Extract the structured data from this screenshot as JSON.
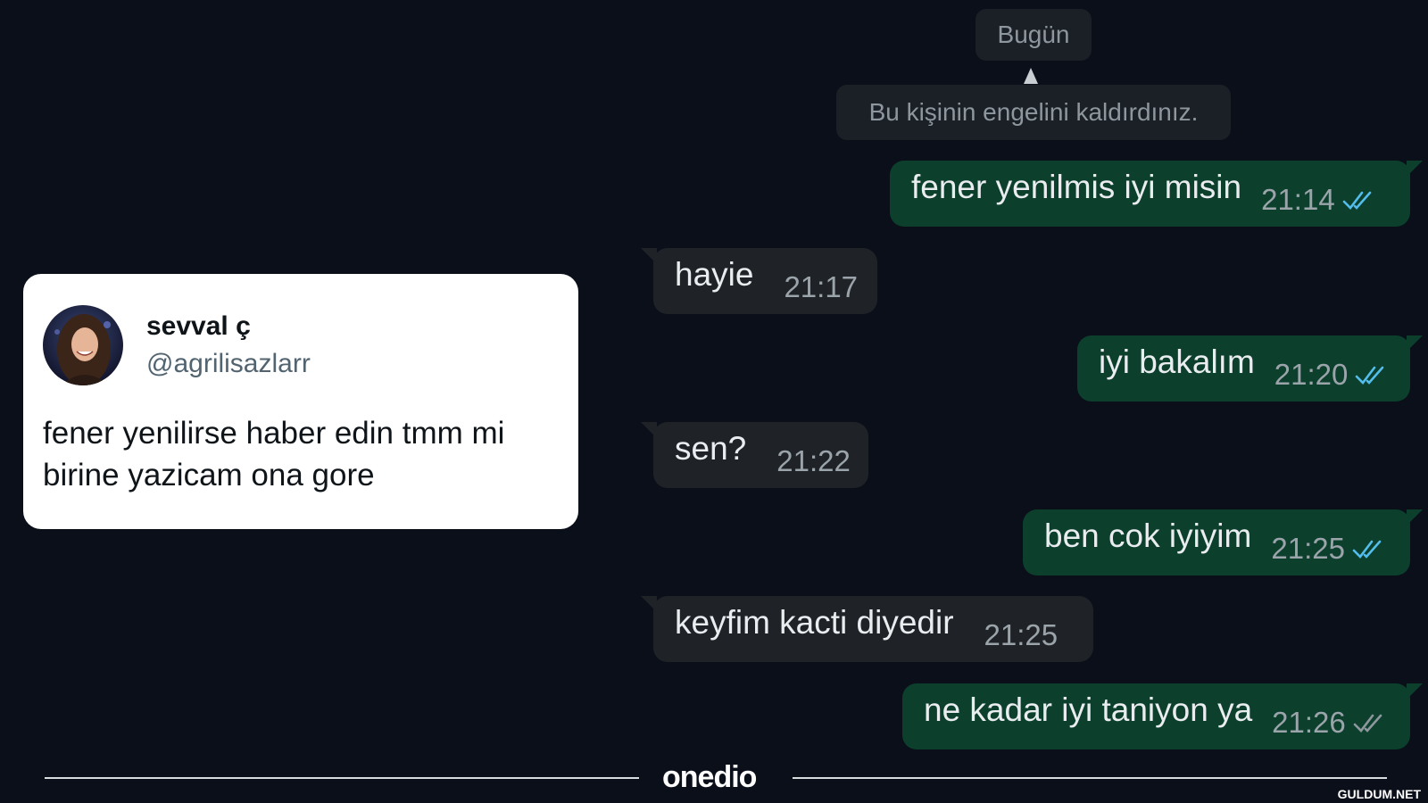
{
  "chat": {
    "date_label": "Bugün",
    "system_message": "Bu kişinin engelini kaldırdınız.",
    "messages": [
      {
        "direction": "out",
        "text": "fener yenilmis iyi misin",
        "time": "21:14",
        "status": "read"
      },
      {
        "direction": "in",
        "text": "hayie",
        "time": "21:17"
      },
      {
        "direction": "out",
        "text": "iyi bakalım",
        "time": "21:20",
        "status": "read"
      },
      {
        "direction": "in",
        "text": "sen?",
        "time": "21:22"
      },
      {
        "direction": "out",
        "text": "ben cok iyiyim",
        "time": "21:25",
        "status": "read"
      },
      {
        "direction": "in",
        "text": "keyfim kacti diyedir",
        "time": "21:25"
      },
      {
        "direction": "out",
        "text": "ne kadar iyi taniyon ya",
        "time": "21:26",
        "status": "delivered"
      }
    ]
  },
  "tweet": {
    "display_name": "sevval ç",
    "handle": "@agrilisazlarr",
    "text": "fener yenilirse haber edin tmm mi birine yazicam ona gore"
  },
  "footer": {
    "brand": "onedio",
    "watermark": "GULDUM.NET"
  },
  "colors": {
    "background": "#0a0f1a",
    "outgoing_bubble": "#0c3f2c",
    "incoming_bubble": "#1f2327",
    "read_tick": "#53bdeb",
    "delivered_tick": "#8d979d"
  },
  "icons": {
    "read_status": "double-check-icon",
    "avatar": "avatar-photo"
  }
}
